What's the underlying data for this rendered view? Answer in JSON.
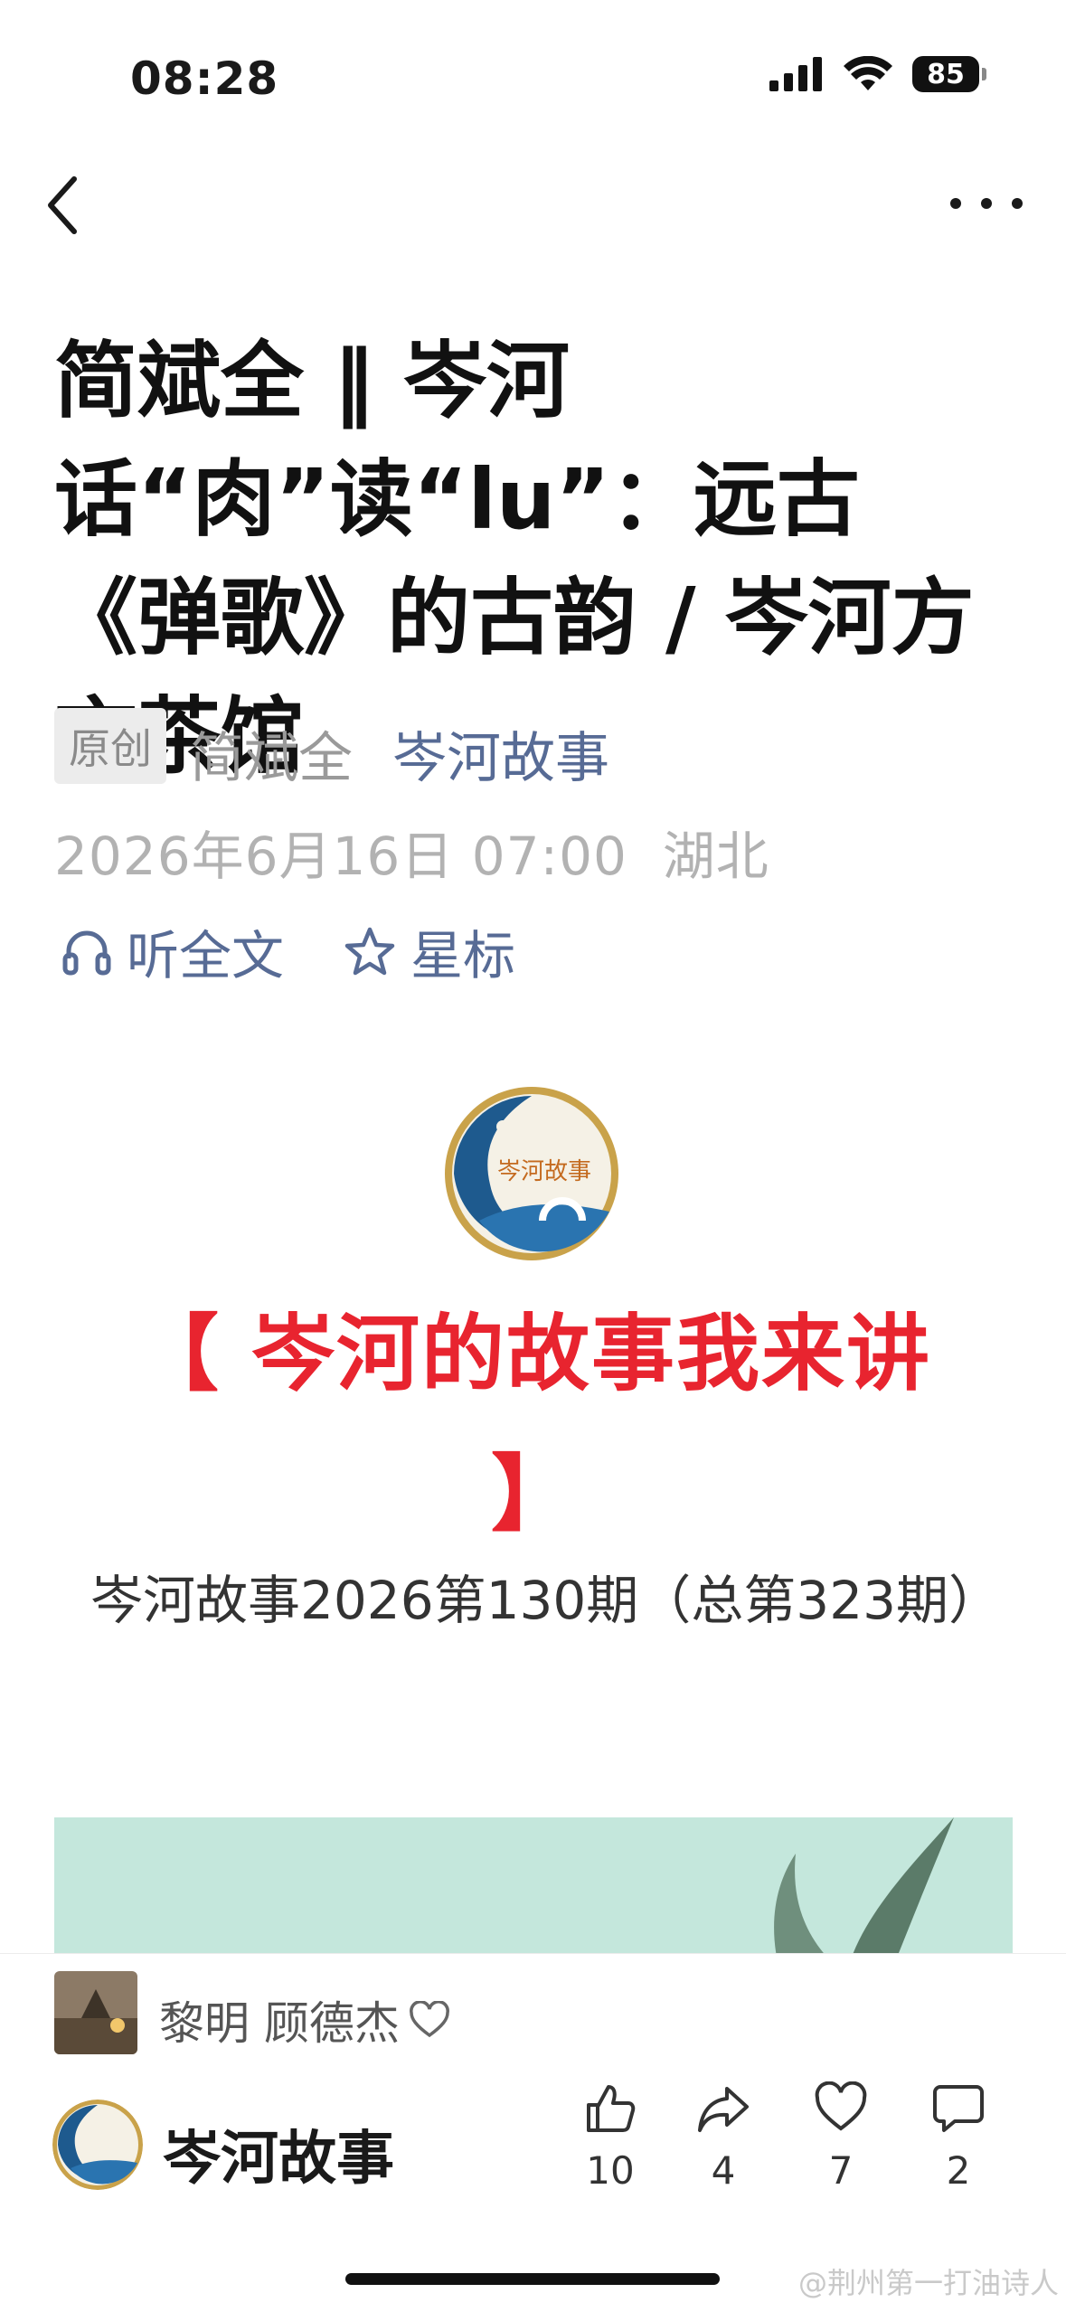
{
  "status_bar": {
    "time": "08:28",
    "battery": "85"
  },
  "nav": {
    "back_icon": "chevron-left-icon",
    "more_icon": "more-dots-icon"
  },
  "article": {
    "title": "简斌全 ‖ 岑河话“肉”读“lu”：远古《弹歌》的古韵 / 岑河方言茶馆",
    "original_badge": "原创",
    "author": "简斌全",
    "account": "岑河故事",
    "date": "2026年6月16日 07:00",
    "location": "湖北",
    "listen_label": "听全文",
    "star_label": "星标",
    "red_heading": "【 岑河的故事我来讲 】",
    "issue_line": "岑河故事2026第130期（总第323期）",
    "logo_text": "岑河故事"
  },
  "bottom": {
    "likers": "黎明  顾德杰",
    "account_name": "岑河故事",
    "actions": {
      "like": "10",
      "share": "4",
      "favorite": "7",
      "comment": "2"
    }
  },
  "watermark": "@荆州第一打油诗人",
  "colors": {
    "link": "#576b95",
    "red": "#e8242f",
    "meta_gray": "#b2b2b2"
  }
}
